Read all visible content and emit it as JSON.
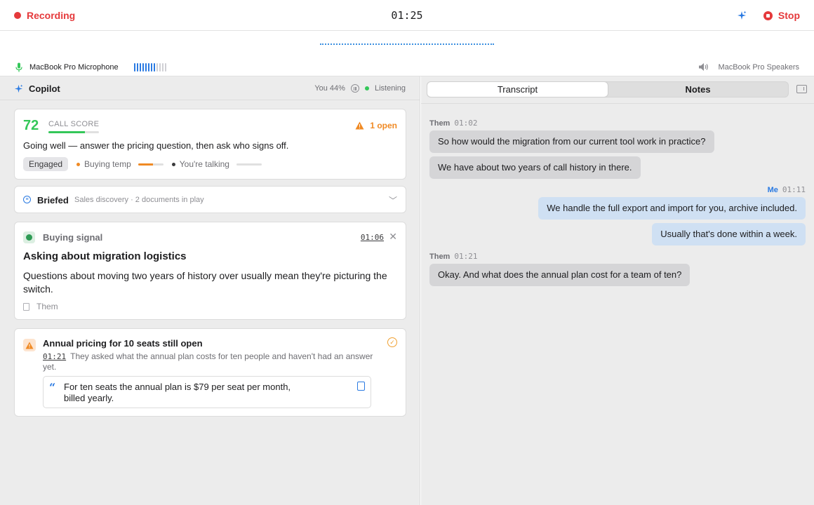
{
  "topbar": {
    "status": "Recording",
    "timer": "01:25",
    "stop_label": "Stop"
  },
  "audio": {
    "mic_name": "MacBook Pro Microphone",
    "mic_level": 0.7,
    "speaker_name": "MacBook Pro Speakers"
  },
  "copilot": {
    "title": "Copilot",
    "talk_share": "You 44%",
    "status": "Listening"
  },
  "score": {
    "value": "72",
    "label": "CALL SCORE",
    "fill_fraction": 0.72,
    "open_count": "1 open",
    "summary": "Going well — answer the pricing question, then ask who signs off.",
    "mood_chip": "Engaged",
    "buying_temp_label": "Buying temp",
    "buying_temp_level": 0.6,
    "talking_label": "You're talking",
    "talking_level": 0.0
  },
  "brief": {
    "title": "Briefed",
    "subtitle": "Sales discovery · 2 documents in play"
  },
  "signal": {
    "type": "Buying signal",
    "time": "01:06",
    "title": "Asking about migration logistics",
    "body": "Questions about moving two years of history over usually mean they're picturing the switch.",
    "source": "Them"
  },
  "open_item": {
    "title": "Annual pricing for 10 seats still open",
    "time": "01:21",
    "description": "They asked what the annual plan costs for ten people and haven't had an answer yet.",
    "quote": "For ten seats the annual plan is $79 per seat per month, billed yearly."
  },
  "tabs": {
    "transcript": "Transcript",
    "notes": "Notes"
  },
  "transcript": [
    {
      "speaker": "Them",
      "time": "01:02",
      "side": "them",
      "lines": [
        "So how would the migration from our current tool work in practice?",
        "We have about two years of call history in there."
      ]
    },
    {
      "speaker": "Me",
      "time": "01:11",
      "side": "me",
      "lines": [
        "We handle the full export and import for you, archive included.",
        "Usually that's done within a week."
      ]
    },
    {
      "speaker": "Them",
      "time": "01:21",
      "side": "them",
      "lines": [
        "Okay. And what does the annual plan cost for a team of ten?"
      ]
    }
  ],
  "colors": {
    "record_red": "#e5393b",
    "accent_blue": "#2a7ae2",
    "good_green": "#34c759",
    "warn_orange": "#f08a24"
  }
}
